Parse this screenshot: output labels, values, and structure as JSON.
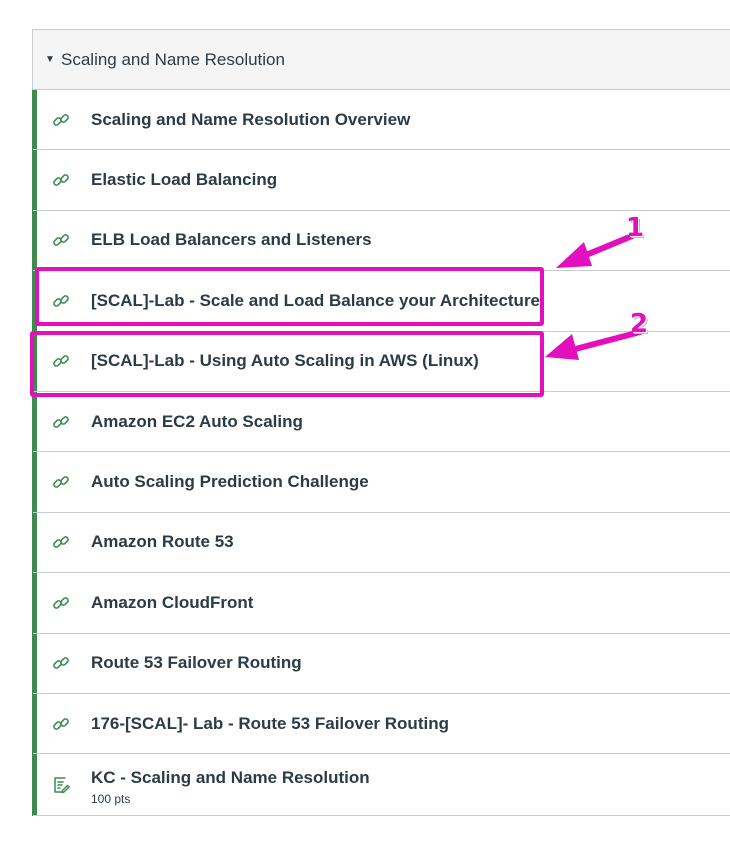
{
  "module": {
    "title": "Scaling and Name Resolution",
    "items": [
      {
        "label": "Scaling and Name Resolution Overview",
        "icon": "link-icon"
      },
      {
        "label": "Elastic Load Balancing",
        "icon": "link-icon"
      },
      {
        "label": "ELB Load Balancers and Listeners",
        "icon": "link-icon"
      },
      {
        "label": "[SCAL]-Lab - Scale and Load Balance your Architecture",
        "icon": "link-icon"
      },
      {
        "label": "[SCAL]-Lab - Using Auto Scaling in AWS (Linux)",
        "icon": "link-icon"
      },
      {
        "label": "Amazon EC2 Auto Scaling",
        "icon": "link-icon"
      },
      {
        "label": "Auto Scaling Prediction Challenge",
        "icon": "link-icon"
      },
      {
        "label": "Amazon Route 53",
        "icon": "link-icon"
      },
      {
        "label": "Amazon CloudFront",
        "icon": "link-icon"
      },
      {
        "label": "Route 53 Failover Routing",
        "icon": "link-icon"
      },
      {
        "label": "176-[SCAL]- Lab - Route 53 Failover Routing",
        "icon": "link-icon"
      },
      {
        "label": "KC - Scaling and Name Resolution",
        "points": "100 pts",
        "icon": "quiz-icon"
      }
    ]
  },
  "annotations": {
    "callout_1": "1",
    "callout_2": "2",
    "highlight_color": "#e30fbd"
  },
  "colors": {
    "module_bar": "#3e8a4f",
    "icon_green": "#3e8a4f"
  }
}
